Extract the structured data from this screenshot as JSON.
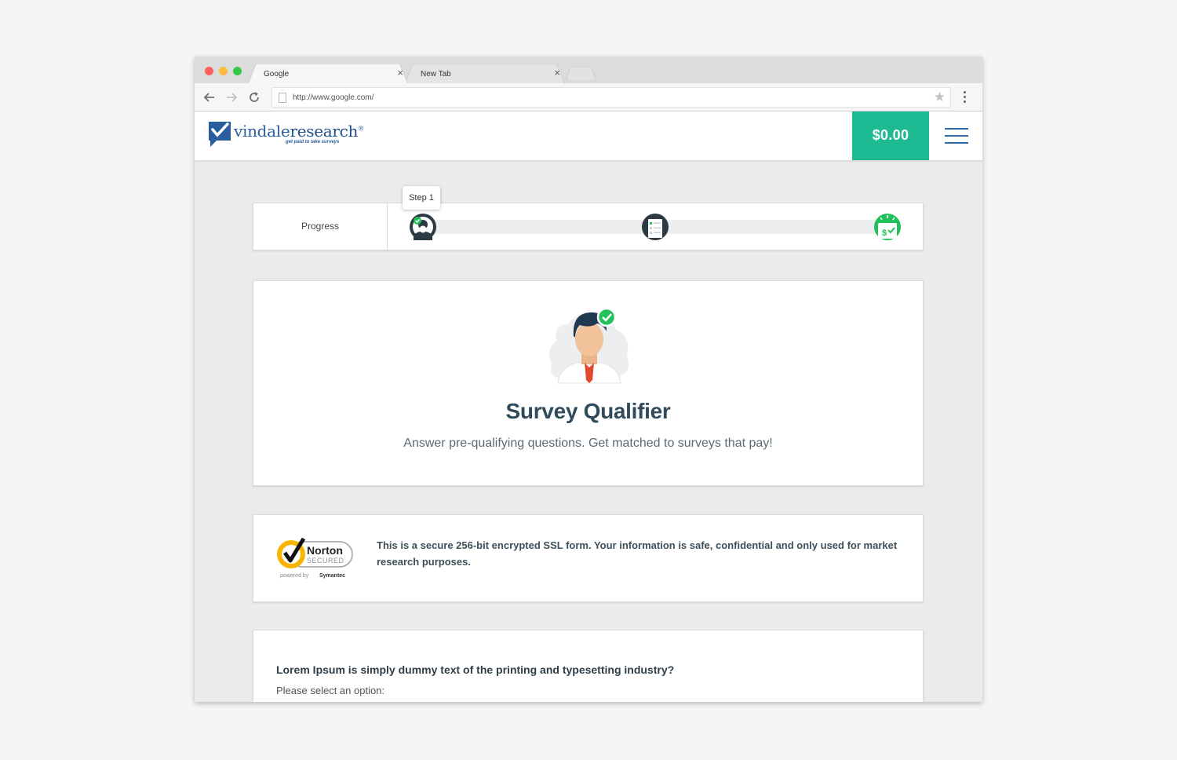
{
  "browser": {
    "tabs": [
      {
        "title": "Google"
      },
      {
        "title": "New Tab"
      }
    ],
    "address_bar": {
      "url": "http://www.google.com/"
    },
    "close_glyph": "×"
  },
  "site": {
    "logo": {
      "word1": "vindale",
      "word2": "research",
      "reg": "®",
      "tagline": "get paid to take surveys"
    },
    "balance": "$0.00"
  },
  "progress": {
    "label": "Progress",
    "tooltip": "Step 1",
    "steps": [
      {
        "icon": "profile-step-icon",
        "state": "active"
      },
      {
        "icon": "survey-step-icon",
        "state": "pending"
      },
      {
        "icon": "payout-step-icon",
        "state": "pending"
      }
    ]
  },
  "hero": {
    "title": "Survey Qualifier",
    "subtitle": "Answer pre-qualifying questions. Get matched to surveys that pay!"
  },
  "security": {
    "badge": {
      "brand": "Norton",
      "secured": "SECURED",
      "powered": "powered by",
      "vendor": "Symantec"
    },
    "text": "This is a secure 256-bit encrypted SSL form. Your information is safe, confidential and only used for market research purposes."
  },
  "question": {
    "text": "Lorem Ipsum is simply dummy text of the printing and typesetting industry?",
    "hint": "Please select an option:"
  },
  "colors": {
    "accent": "#1dba93",
    "brand_blue": "#2a5d9e",
    "title_text": "#2f4a5a",
    "check_green": "#21c05a"
  }
}
